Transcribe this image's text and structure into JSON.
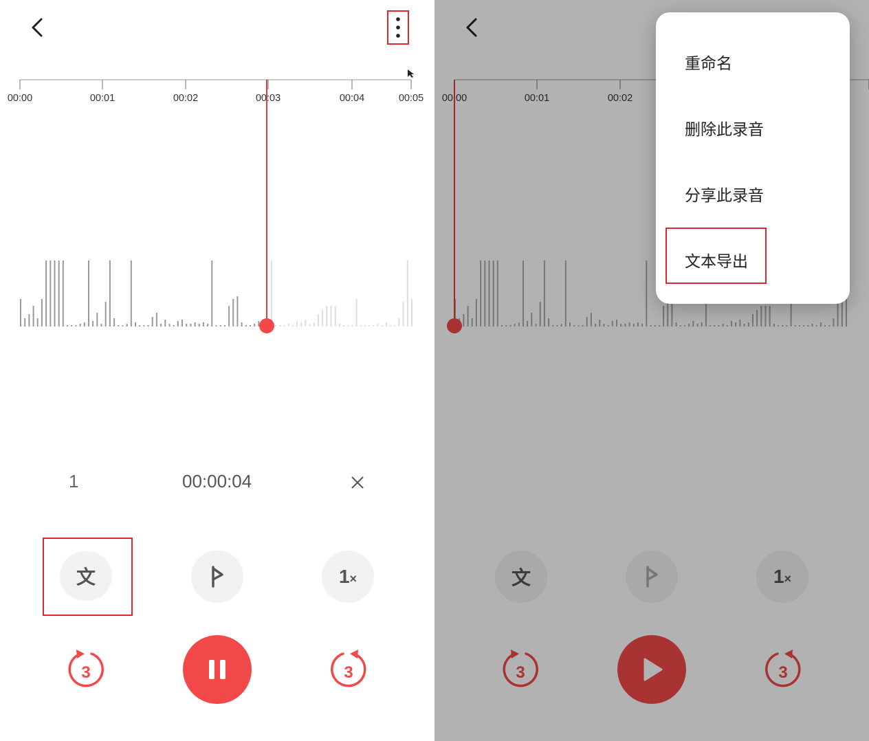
{
  "timeline": {
    "ticks": [
      "00:00",
      "00:01",
      "00:02",
      "00:03",
      "00:04",
      "00:05"
    ]
  },
  "playback": {
    "mark_index": "1",
    "current_time": "00:00:04"
  },
  "controls": {
    "transcribe_label": "文",
    "speed_label": "1",
    "speed_suffix": "×",
    "skip_seconds": "3"
  },
  "colors": {
    "accent": "#f24848",
    "accent_dim": "#b23232",
    "highlight": "#e0262c"
  },
  "menu": {
    "items": [
      "重命名",
      "删除此录音",
      "分享此录音",
      "文本导出"
    ]
  }
}
